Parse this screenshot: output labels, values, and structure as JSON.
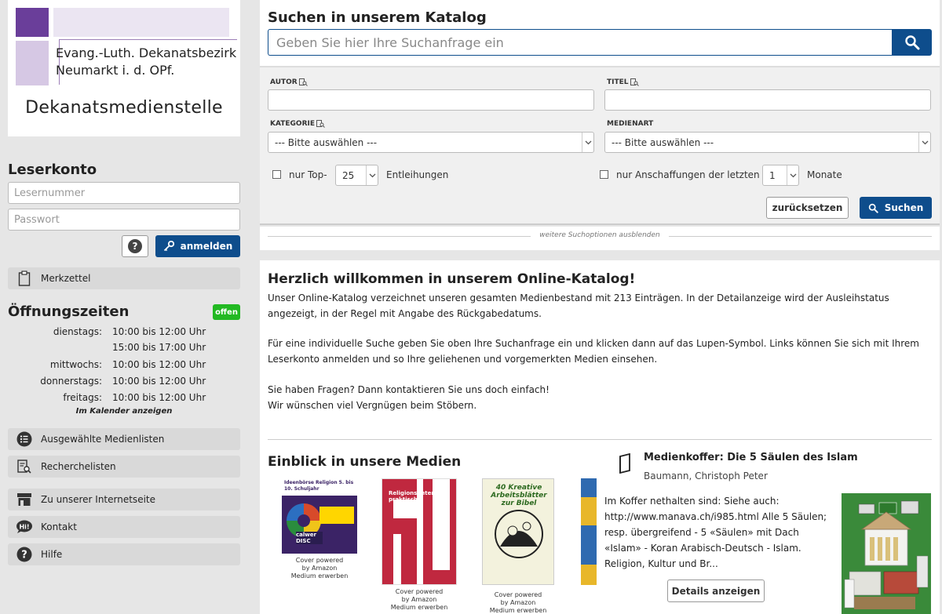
{
  "logo": {
    "org_line1": "Evang.-Luth. Dekanatsbezirk",
    "org_line2": "Neumarkt i. d. OPf.",
    "name": "Dekanatsmedienstelle",
    "colors": {
      "dark": "#6a3e9a",
      "light": "#d6c8e4",
      "lighter": "#ebe5f2"
    }
  },
  "account": {
    "title": "Leserkonto",
    "user_placeholder": "Lesernummer",
    "pass_placeholder": "Passwort",
    "help_label": "?",
    "login_label": "anmelden"
  },
  "sidebar_top": {
    "merkzettel": "Merkzettel"
  },
  "opening": {
    "title": "Öffnungszeiten",
    "status": "offen",
    "rows": [
      {
        "day": "dienstags:",
        "time": "10:00 bis 12:00 Uhr"
      },
      {
        "day": "",
        "time": "15:00 bis 17:00 Uhr"
      },
      {
        "day": "mittwochs:",
        "time": "10:00 bis 12:00 Uhr"
      },
      {
        "day": "donnerstags:",
        "time": "10:00 bis 12:00 Uhr"
      },
      {
        "day": "freitags:",
        "time": "10:00 bis 12:00 Uhr"
      }
    ],
    "calendar_link": "Im Kalender anzeigen"
  },
  "sidebar_nav": [
    {
      "label": "Ausgewählte Medienlisten",
      "icon": "list-icon"
    },
    {
      "label": "Recherchelisten",
      "icon": "search-list-icon"
    },
    {
      "label": "Zu unserer Internetseite",
      "icon": "store-icon"
    },
    {
      "label": "Kontakt",
      "icon": "chat-icon"
    },
    {
      "label": "Hilfe",
      "icon": "help-icon"
    }
  ],
  "search": {
    "title": "Suchen in unserem Katalog",
    "placeholder": "Geben Sie hier Ihre Suchanfrage ein"
  },
  "advanced": {
    "author_label": "AUTOR",
    "title_label": "TITEL",
    "category_label": "KATEGORIE",
    "mediatype_label": "MEDIENART",
    "category_value": "--- Bitte auswählen ---",
    "mediatype_value": "--- Bitte auswählen ---",
    "top_prefix": "nur Top-",
    "top_value": "25",
    "top_suffix": "Entleihungen",
    "new_prefix": "nur Anschaffungen der letzten",
    "new_value": "1",
    "new_suffix": "Monate",
    "reset_label": "zurücksetzen",
    "submit_label": "Suchen",
    "more_options": "weitere Suchoptionen ausblenden"
  },
  "welcome": {
    "title": "Herzlich willkommen in unserem Online-Katalog!",
    "p1": "Unser Online-Katalog verzeichnet unseren gesamten Medienbestand mit 213 Einträgen. In der Detailanzeige wird der Ausleihstatus angezeigt, in der Regel mit Angabe des Rückgabedatums.",
    "p2": "Für eine individuelle Suche geben Sie oben Ihre Suchanfrage ein und klicken dann auf das Lupen-Symbol. Links können Sie sich mit Ihrem Leserkonto anmelden und so Ihre geliehenen und vorgemerkten Medien einsehen.",
    "p3a": "Sie haben Fragen? Dann kontaktieren Sie uns doch einfach!",
    "p3b": "Wir wünschen viel Vergnügen beim Stöbern."
  },
  "einblick": {
    "title": "Einblick in unsere Medien",
    "covers": [
      {
        "cover_text": "Ideenbörse Religion 5. bis 10. Schuljahr",
        "publisher": "calwer DISC",
        "caption1": "Cover powered",
        "caption2": "by Amazon",
        "caption3": "Medium erwerben"
      },
      {
        "cover_text": "Religionsunterricht praktisch",
        "caption1": "Cover powered",
        "caption2": "by Amazon",
        "caption3": "Medium erwerben"
      },
      {
        "cover_text": "40 Kreative Arbeitsblätter zur Bibel",
        "caption1": "Cover powered",
        "caption2": "by Amazon",
        "caption3": "Medium erwerben"
      }
    ]
  },
  "detail": {
    "title": "Medienkoffer: Die 5 Säulen des Islam",
    "author": "Baumann, Christoph Peter",
    "text": "Im Koffer nethalten sind: Siehe auch: http://www.manava.ch/i985.html Alle 5 Säulen; resp. übergreifend - 5 «Säulen» mit Dach «Islam» - Koran Arabisch-Deutsch - Islam. Religion, Kultur und Br...",
    "button": "Details anzeigen"
  }
}
